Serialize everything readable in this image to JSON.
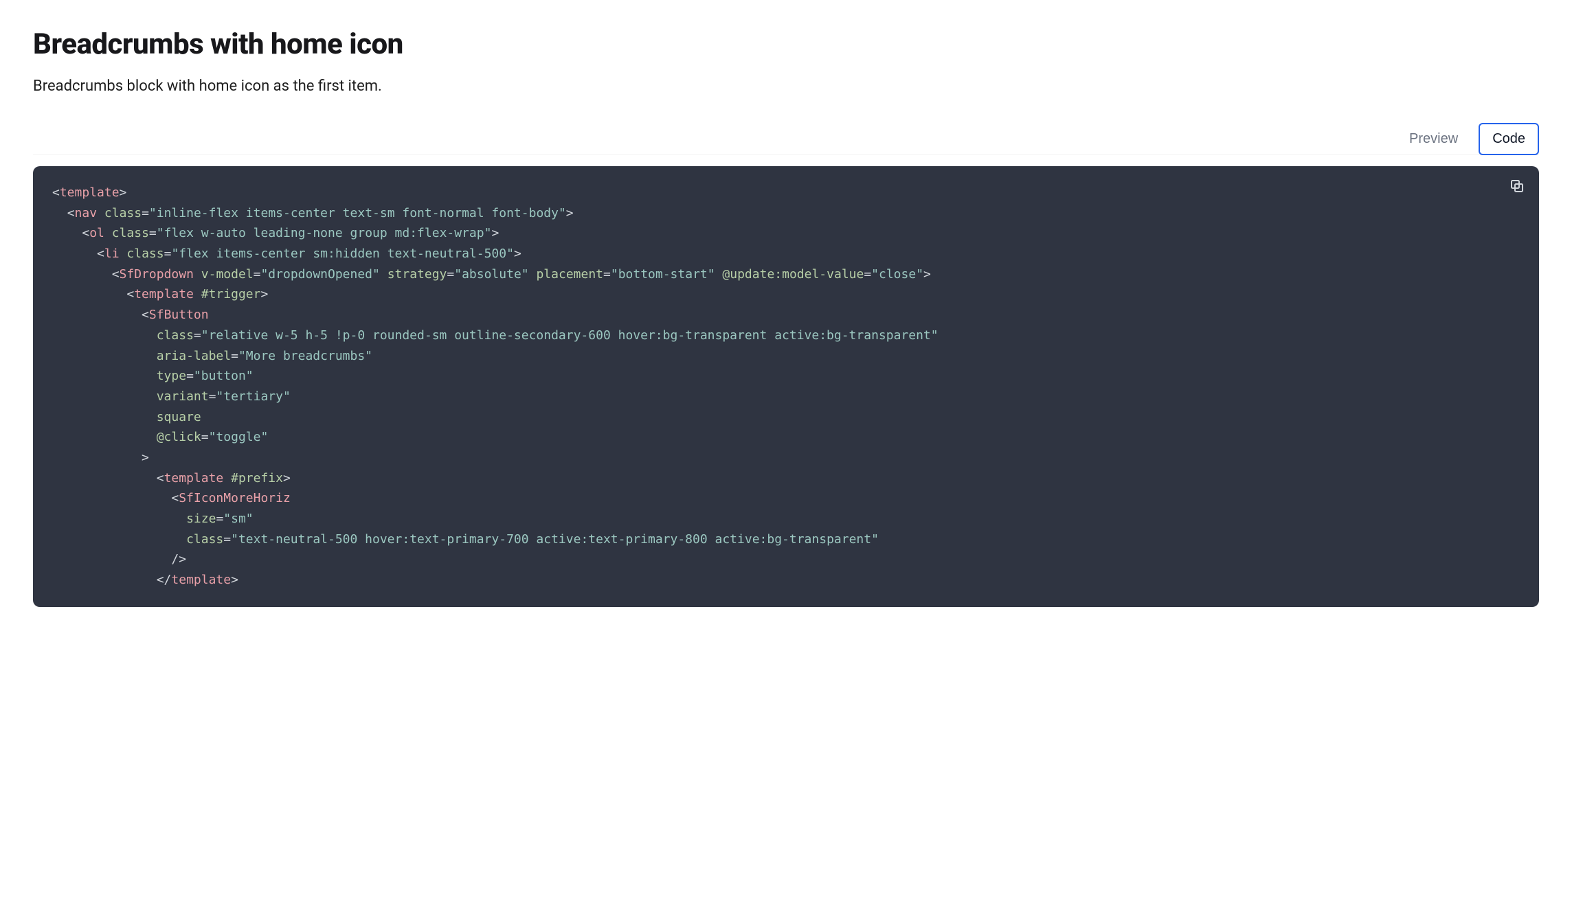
{
  "header": {
    "title": "Breadcrumbs with home icon",
    "description": "Breadcrumbs block with home icon as the first item."
  },
  "tabs": {
    "preview": "Preview",
    "code": "Code"
  },
  "code": {
    "l1": {
      "open": "<",
      "tag": "template",
      "close": ">"
    },
    "l2": {
      "open": "<",
      "tag": "nav",
      "sp": " ",
      "a1": "class",
      "eq": "=",
      "v1": "\"inline-flex items-center text-sm font-normal font-body\"",
      "close": ">"
    },
    "l3": {
      "open": "<",
      "tag": "ol",
      "sp": " ",
      "a1": "class",
      "eq": "=",
      "v1": "\"flex w-auto leading-none group md:flex-wrap\"",
      "close": ">"
    },
    "l4": {
      "open": "<",
      "tag": "li",
      "sp": " ",
      "a1": "class",
      "eq": "=",
      "v1": "\"flex items-center sm:hidden text-neutral-500\"",
      "close": ">"
    },
    "l5": {
      "open": "<",
      "tag": "SfDropdown",
      "sp": " ",
      "a1": "v-model",
      "eq1": "=",
      "v1": "\"dropdownOpened\"",
      "sp2": " ",
      "a2": "strategy",
      "eq2": "=",
      "v2": "\"absolute\"",
      "sp3": " ",
      "a3": "placement",
      "eq3": "=",
      "v3": "\"bottom-start\"",
      "sp4": " ",
      "a4": "@update:model-value",
      "eq4": "=",
      "v4": "\"close\"",
      "close": ">"
    },
    "l6": {
      "open": "<",
      "tag": "template",
      "sp": " ",
      "a1": "#trigger",
      "close": ">"
    },
    "l7": {
      "open": "<",
      "tag": "SfButton"
    },
    "l8": {
      "a": "class",
      "eq": "=",
      "v": "\"relative w-5 h-5 !p-0 rounded-sm outline-secondary-600 hover:bg-transparent active:bg-transparent\""
    },
    "l9": {
      "a": "aria-label",
      "eq": "=",
      "v": "\"More breadcrumbs\""
    },
    "l10": {
      "a": "type",
      "eq": "=",
      "v": "\"button\""
    },
    "l11": {
      "a": "variant",
      "eq": "=",
      "v": "\"tertiary\""
    },
    "l12": {
      "a": "square"
    },
    "l13": {
      "a": "@click",
      "eq": "=",
      "v": "\"toggle\""
    },
    "l14": {
      "close": ">"
    },
    "l15": {
      "open": "<",
      "tag": "template",
      "sp": " ",
      "a1": "#prefix",
      "close": ">"
    },
    "l16": {
      "open": "<",
      "tag": "SfIconMoreHoriz"
    },
    "l17": {
      "a": "size",
      "eq": "=",
      "v": "\"sm\""
    },
    "l18": {
      "a": "class",
      "eq": "=",
      "v": "\"text-neutral-500 hover:text-primary-700 active:text-primary-800 active:bg-transparent\""
    },
    "l19": {
      "close": "/>"
    },
    "l20": {
      "open": "</",
      "tag": "template",
      "close": ">"
    }
  }
}
